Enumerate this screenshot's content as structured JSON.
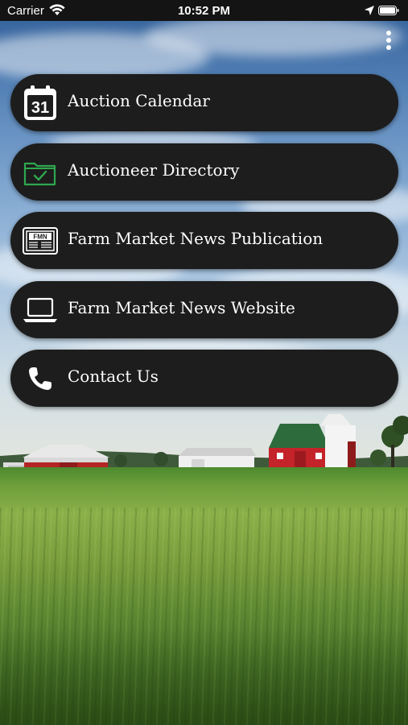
{
  "status_bar": {
    "carrier": "Carrier",
    "time": "10:52 PM"
  },
  "menu": {
    "items": [
      {
        "label": "Auction Calendar",
        "icon": "calendar-icon",
        "icon_text": "31"
      },
      {
        "label": "Auctioneer Directory",
        "icon": "folder-check-icon",
        "icon_color": "#2fa84f"
      },
      {
        "label": "Farm Market News Publication",
        "icon": "newspaper-icon",
        "icon_text": "FMN"
      },
      {
        "label": "Farm Market News Website",
        "icon": "laptop-icon"
      },
      {
        "label": "Contact Us",
        "icon": "phone-icon"
      }
    ]
  },
  "colors": {
    "button_bg": "#1d1d1d",
    "button_text": "#ffffff",
    "status_bar_bg": "#141414"
  }
}
